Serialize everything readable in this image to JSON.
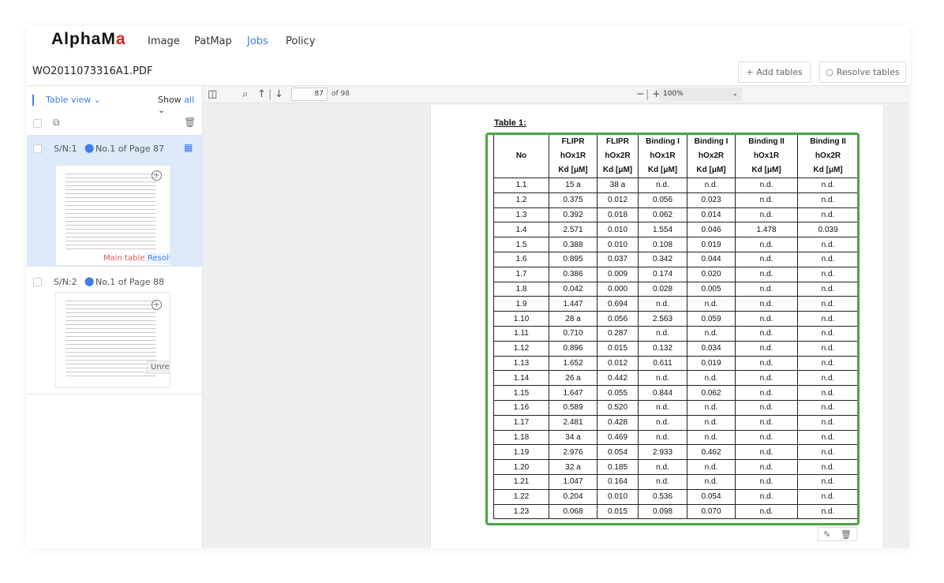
{
  "nav": {
    "logo_main": "AlphaM",
    "logo_accent": "a",
    "items": [
      "Image",
      "PatMap",
      "Jobs",
      "Policy"
    ],
    "active": "Jobs"
  },
  "file": {
    "name": "WO2011073316A1.PDF",
    "add_tables": "Add tables",
    "resolve_tables": "Resolve tables"
  },
  "left_panel": {
    "view_label": "Table view",
    "show_label": "Show",
    "show_value": "all",
    "items": [
      {
        "sn": "S/N:1",
        "title": "No.1 of Page 87",
        "tags": [
          "Main table",
          "Resolved"
        ]
      },
      {
        "sn": "S/N:2",
        "title": "No.1 of Page 88",
        "tags": [
          "Unresolved"
        ]
      }
    ]
  },
  "viewer": {
    "current_page": "87",
    "of_pages": "of 98",
    "zoom": "100%"
  },
  "document": {
    "caption": "Table 1:",
    "header_rows": [
      [
        "",
        "FLIPR",
        "FLIPR",
        "Binding I",
        "Binding I",
        "Binding II",
        "Binding II"
      ],
      [
        "No",
        "hOx1R",
        "hOx2R",
        "hOx1R",
        "hOx2R",
        "hOx1R",
        "hOx2R"
      ],
      [
        "",
        "Kd [μM]",
        "Kd [μM]",
        "Kd [μM]",
        "Kd [μM]",
        "Kd [μM]",
        "Kd [μM]"
      ]
    ],
    "rows": [
      [
        "1.1",
        "15 a",
        "38 a",
        "n.d.",
        "n.d.",
        "n.d.",
        "n.d."
      ],
      [
        "1.2",
        "0.375",
        "0.012",
        "0.056",
        "0.023",
        "n.d.",
        "n.d."
      ],
      [
        "1.3",
        "0.392",
        "0.018",
        "0.062",
        "0.014",
        "n.d.",
        "n.d."
      ],
      [
        "1.4",
        "2.571",
        "0.010",
        "1.554",
        "0.046",
        "1.478",
        "0.039"
      ],
      [
        "1.5",
        "0.388",
        "0.010",
        "0.108",
        "0.019",
        "n.d.",
        "n.d."
      ],
      [
        "1.6",
        "0.895",
        "0.037",
        "0.342",
        "0.044",
        "n.d.",
        "n.d."
      ],
      [
        "1.7",
        "0.386",
        "0.009",
        "0.174",
        "0.020",
        "n.d.",
        "n.d."
      ],
      [
        "1.8",
        "0.042",
        "0.000",
        "0.028",
        "0.005",
        "n.d.",
        "n.d."
      ],
      [
        "1.9",
        "1.447",
        "0.694",
        "n.d.",
        "n.d.",
        "n.d.",
        "n.d."
      ],
      [
        "1.10",
        "28 a",
        "0.056",
        "2.563",
        "0.059",
        "n.d.",
        "n.d."
      ],
      [
        "1.11",
        "0.710",
        "0.287",
        "n.d.",
        "n.d.",
        "n.d.",
        "n.d."
      ],
      [
        "1.12",
        "0.896",
        "0.015",
        "0.132",
        "0.034",
        "n.d.",
        "n.d."
      ],
      [
        "1.13",
        "1.652",
        "0.012",
        "0.611",
        "0.019",
        "n.d.",
        "n.d."
      ],
      [
        "1.14",
        "26 a",
        "0.442",
        "n.d.",
        "n.d.",
        "n.d.",
        "n.d."
      ],
      [
        "1.15",
        "1.647",
        "0.055",
        "0.844",
        "0.062",
        "n.d.",
        "n.d."
      ],
      [
        "1.16",
        "0.589",
        "0.520",
        "n.d.",
        "n.d.",
        "n.d.",
        "n.d."
      ],
      [
        "1.17",
        "2.481",
        "0.428",
        "n.d.",
        "n.d.",
        "n.d.",
        "n.d."
      ],
      [
        "1.18",
        "34 a",
        "0.469",
        "n.d.",
        "n.d.",
        "n.d.",
        "n.d."
      ],
      [
        "1.19",
        "2.976",
        "0.054",
        "2.933",
        "0.462",
        "n.d.",
        "n.d."
      ],
      [
        "1.20",
        "32 a",
        "0.185",
        "n.d.",
        "n.d.",
        "n.d.",
        "n.d."
      ],
      [
        "1.21",
        "1.047",
        "0.164",
        "n.d.",
        "n.d.",
        "n.d.",
        "n.d."
      ],
      [
        "1.22",
        "0.204",
        "0.010",
        "0.536",
        "0.054",
        "n.d.",
        "n.d."
      ],
      [
        "1.23",
        "0.068",
        "0.015",
        "0.098",
        "0.070",
        "n.d.",
        "n.d."
      ]
    ]
  },
  "colors": {
    "accent": "#3d7ee8",
    "logo_red": "#d9261c",
    "selection_green": "#4aa442",
    "selected_item_bg": "#dceafa"
  }
}
